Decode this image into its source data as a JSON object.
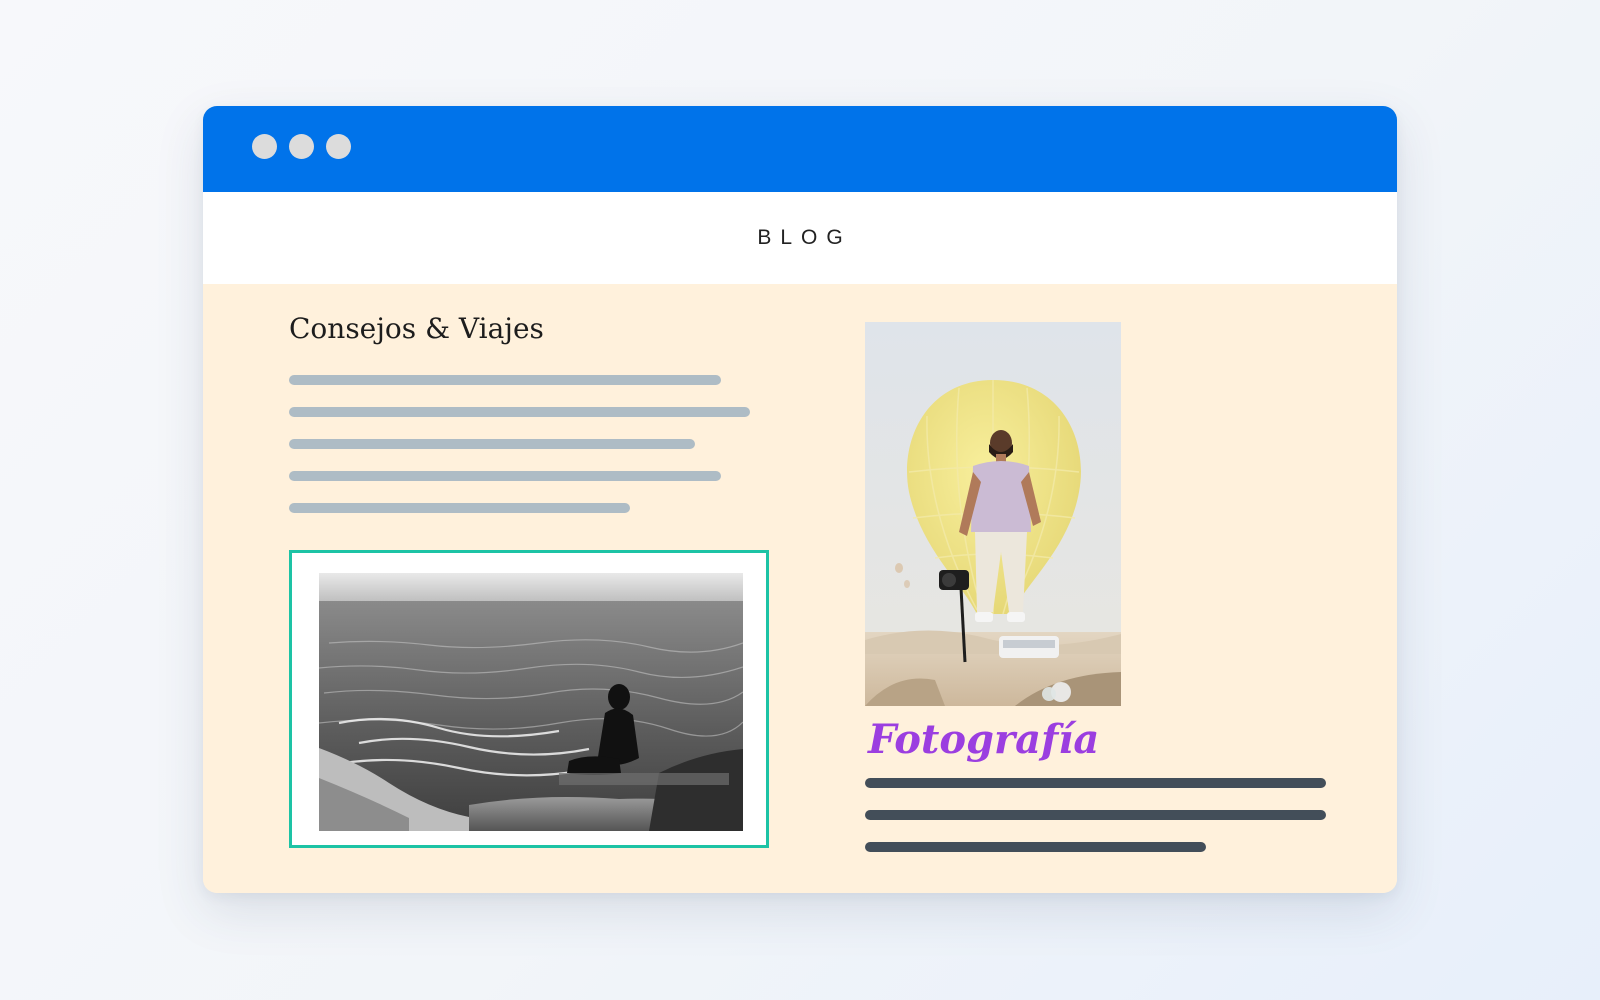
{
  "colors": {
    "titlebar": "#0073ea",
    "window_dot": "#dcdcdc",
    "content_bg": "#fff1dc",
    "text_line_light": "#aebcc5",
    "text_line_dark": "#434e59",
    "frame_border": "#1dc3a5",
    "accent_purple": "#9b3ee0"
  },
  "window": {
    "controls": [
      "window-dot",
      "window-dot",
      "window-dot"
    ]
  },
  "nav": {
    "title": "BLOG"
  },
  "left_post": {
    "title": "Consejos & Viajes",
    "image": "black-and-white sea photo"
  },
  "right_post": {
    "title": "Fotografía",
    "image": "hot air balloon photo"
  }
}
